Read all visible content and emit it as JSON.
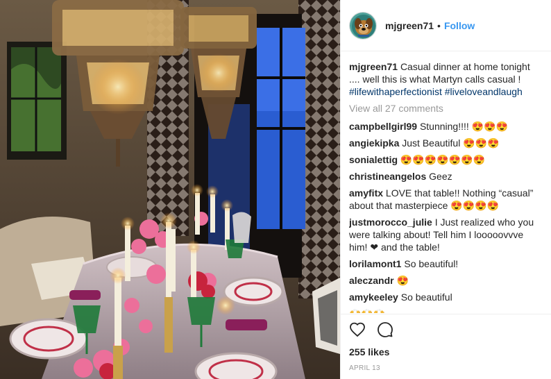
{
  "post": {
    "image_alt": "",
    "header": {
      "username": "mjgreen71",
      "separator": "•",
      "follow_label": "Follow"
    },
    "caption": {
      "username": "mjgreen71",
      "text": "Casual dinner at home tonight .... well this is what Martyn calls casual !",
      "hashtags": "#lifewithaperfectionist #liveloveandlaugh"
    },
    "view_all_label": "View all 27 comments",
    "comments": [
      {
        "user": "campbellgirl99",
        "text": "Stunning!!!! 😍😍😍"
      },
      {
        "user": "angiekipka",
        "text": "Just Beautiful 😍😍😍"
      },
      {
        "user": "sonialettig",
        "text": "😍😍😍😍😍😍😍"
      },
      {
        "user": "christineangelos",
        "text": "Geez"
      },
      {
        "user": "amyfitx",
        "text": "LOVE that table!! Nothing “casual” about that masterpiece 😍😍😍😍"
      },
      {
        "user": "justmorocco_julie",
        "text": "I Just realized who you were talking about! Tell him I looooovvve him! ❤ and the table!"
      },
      {
        "user": "lorilamont1",
        "text": "So beautiful!"
      },
      {
        "user": "aleczandr",
        "text": "😍"
      },
      {
        "user": "amykeeley",
        "text": "So beautiful"
      },
      {
        "user": "",
        "text": "🙌🙌🙌"
      }
    ],
    "likes_label": "255 likes",
    "date_label": "APRIL 13",
    "icons": {
      "like": "heart-icon",
      "comment": "speech-bubble-icon"
    }
  }
}
